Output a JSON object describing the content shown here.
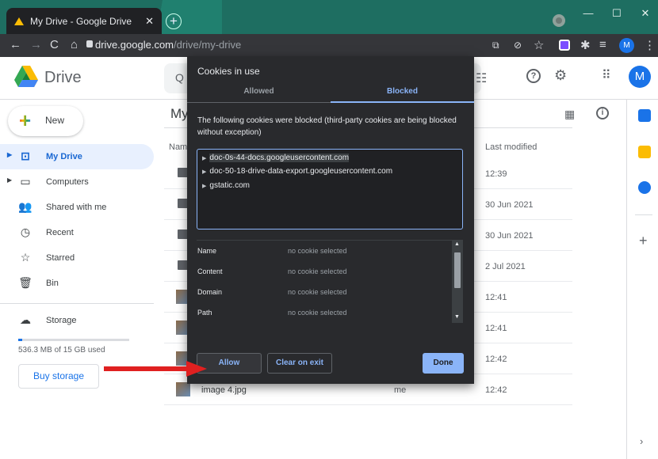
{
  "browser": {
    "tab_title": "My Drive - Google Drive",
    "url_host": "drive.google.com",
    "url_path": "/drive/my-drive",
    "profile_initial": "M"
  },
  "drive": {
    "brand": "Drive",
    "page_title": "My",
    "new_label": "New",
    "nav": [
      {
        "label": "My Drive",
        "icon": "my-drive-icon"
      },
      {
        "label": "Computers",
        "icon": "computer-icon"
      },
      {
        "label": "Shared with me",
        "icon": "shared-icon"
      },
      {
        "label": "Recent",
        "icon": "clock-icon"
      },
      {
        "label": "Starred",
        "icon": "star-icon"
      },
      {
        "label": "Bin",
        "icon": "bin-icon"
      }
    ],
    "storage_label": "Storage",
    "storage_used_text": "536.3 MB of 15 GB used",
    "storage_fraction": 0.035,
    "buy_storage": "Buy storage",
    "column_name": "Nam",
    "column_modified": "Last modified",
    "rows": [
      {
        "kind": "folder",
        "modified": "12:39"
      },
      {
        "kind": "folder",
        "modified": "30 Jun 2021"
      },
      {
        "kind": "folder",
        "modified": "30 Jun 2021"
      },
      {
        "kind": "folder",
        "modified": "2 Jul 2021"
      },
      {
        "kind": "image",
        "modified": "12:41"
      },
      {
        "kind": "image",
        "modified": "12:41"
      },
      {
        "kind": "image",
        "modified": "12:42"
      },
      {
        "kind": "image",
        "name": "image 4.jpg",
        "owner": "me",
        "modified": "12:42"
      }
    ]
  },
  "dialog": {
    "title": "Cookies in use",
    "tab_allowed": "Allowed",
    "tab_blocked": "Blocked",
    "description": "The following cookies were blocked (third-party cookies are being blocked without exception)",
    "domains": [
      "doc-0s-44-docs.googleusercontent.com",
      "doc-50-18-drive-data-export.googleusercontent.com",
      "gstatic.com"
    ],
    "properties": [
      {
        "key": "Name",
        "value": "no cookie selected"
      },
      {
        "key": "Content",
        "value": "no cookie selected"
      },
      {
        "key": "Domain",
        "value": "no cookie selected"
      },
      {
        "key": "Path",
        "value": "no cookie selected"
      }
    ],
    "allow_button": "Allow",
    "clear_button": "Clear on exit",
    "done_button": "Done"
  },
  "colors": {
    "accent": "#1a73e8",
    "dialog_bg": "#292a2d",
    "annotation_arrow": "#e02020"
  }
}
